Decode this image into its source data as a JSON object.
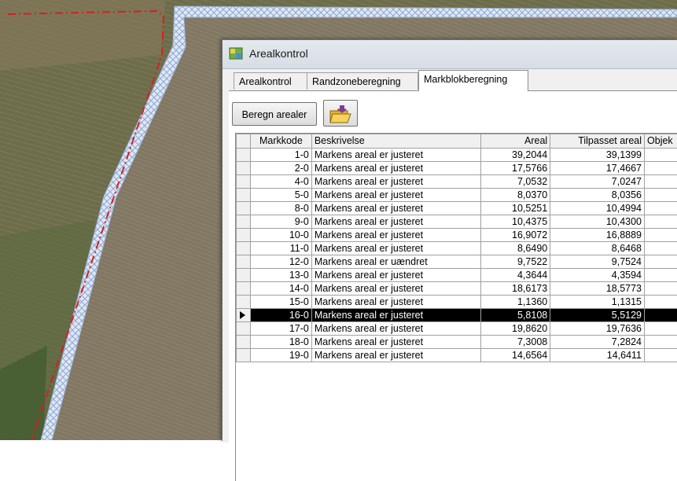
{
  "window": {
    "title": "Arealkontrol",
    "icon": "app-map-icon"
  },
  "tabs": [
    {
      "label": "Arealkontrol",
      "active": false
    },
    {
      "label": "Randzoneberegning",
      "active": false
    },
    {
      "label": "Markblokberegning",
      "active": true
    }
  ],
  "toolbar": {
    "calc_label": "Beregn arealer",
    "open_icon": "folder-open-icon"
  },
  "table": {
    "headers": {
      "code": "Markkode",
      "desc": "Beskrivelse",
      "area": "Areal",
      "adjusted": "Tilpasset areal",
      "object": "Objek"
    },
    "rows": [
      {
        "code": "1-0",
        "desc": "Markens areal er justeret",
        "area": "39,2044",
        "adjusted": "39,1399"
      },
      {
        "code": "2-0",
        "desc": "Markens areal er justeret",
        "area": "17,5766",
        "adjusted": "17,4667"
      },
      {
        "code": "4-0",
        "desc": "Markens areal er justeret",
        "area": "7,0532",
        "adjusted": "7,0247"
      },
      {
        "code": "5-0",
        "desc": "Markens areal er justeret",
        "area": "8,0370",
        "adjusted": "8,0356"
      },
      {
        "code": "8-0",
        "desc": "Markens areal er justeret",
        "area": "10,5251",
        "adjusted": "10,4994"
      },
      {
        "code": "9-0",
        "desc": "Markens areal er justeret",
        "area": "10,4375",
        "adjusted": "10,4300"
      },
      {
        "code": "10-0",
        "desc": "Markens areal er justeret",
        "area": "16,9072",
        "adjusted": "16,8889"
      },
      {
        "code": "11-0",
        "desc": "Markens areal er justeret",
        "area": "8,6490",
        "adjusted": "8,6468"
      },
      {
        "code": "12-0",
        "desc": "Markens areal er uændret",
        "area": "9,7522",
        "adjusted": "9,7524"
      },
      {
        "code": "13-0",
        "desc": "Markens areal er justeret",
        "area": "4,3644",
        "adjusted": "4,3594"
      },
      {
        "code": "14-0",
        "desc": "Markens areal er justeret",
        "area": "18,6173",
        "adjusted": "18,5773"
      },
      {
        "code": "15-0",
        "desc": "Markens areal er justeret",
        "area": "1,1360",
        "adjusted": "1,1315"
      },
      {
        "code": "16-0",
        "desc": "Markens areal er justeret",
        "area": "5,8108",
        "adjusted": "5,5129",
        "selected": true
      },
      {
        "code": "17-0",
        "desc": "Markens areal er justeret",
        "area": "19,8620",
        "adjusted": "19,7636"
      },
      {
        "code": "18-0",
        "desc": "Markens areal er justeret",
        "area": "7,3008",
        "adjusted": "7,2824"
      },
      {
        "code": "19-0",
        "desc": "Markens areal er justeret",
        "area": "14,6564",
        "adjusted": "14,6411"
      }
    ]
  },
  "colors": {
    "selected_row": "#000000",
    "field_boundary": "#d42020",
    "block_hatch": "#b8c8e6",
    "field_green": "#5f6a43"
  }
}
